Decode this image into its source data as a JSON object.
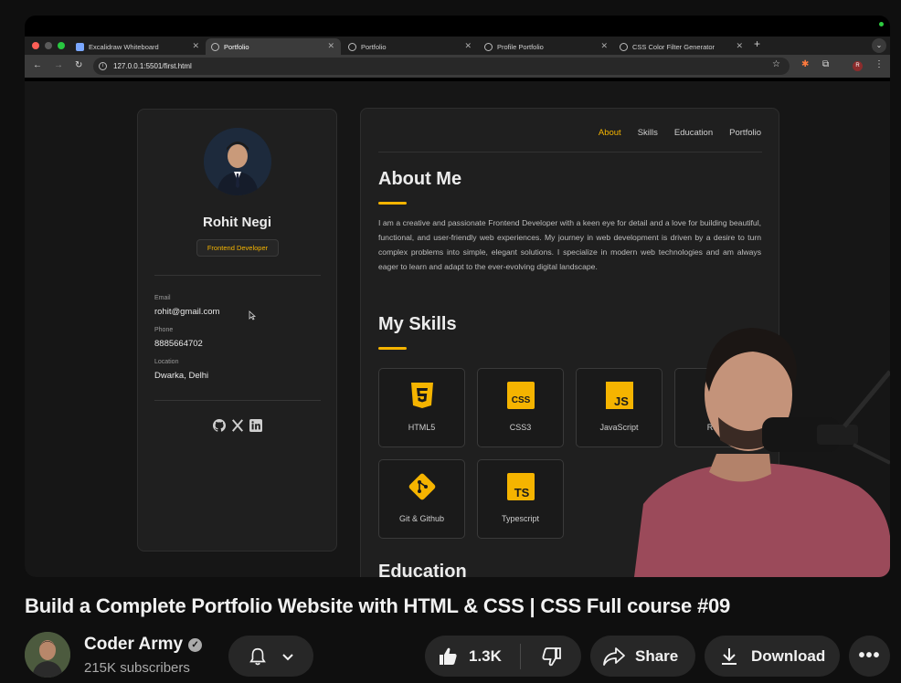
{
  "browser": {
    "tabs": [
      {
        "title": "Excalidraw Whiteboard",
        "active": false
      },
      {
        "title": "Portfolio",
        "active": true
      },
      {
        "title": "Portfolio",
        "active": false
      },
      {
        "title": "Profile Portfolio",
        "active": false
      },
      {
        "title": "CSS Color Filter Generator",
        "active": false
      }
    ],
    "url": "127.0.0.1:5501/first.html",
    "profile_initial": "R"
  },
  "profile": {
    "name": "Rohit Negi",
    "role": "Frontend Developer",
    "contacts": [
      {
        "label": "Email",
        "value": "rohit@gmail.com"
      },
      {
        "label": "Phone",
        "value": "8885664702"
      },
      {
        "label": "Location",
        "value": "Dwarka, Delhi"
      }
    ],
    "socials": [
      "github-icon",
      "x-icon",
      "linkedin-icon"
    ]
  },
  "nav": {
    "items": [
      "About",
      "Skills",
      "Education",
      "Portfolio"
    ],
    "active": "About"
  },
  "about": {
    "title": "About Me",
    "text": "I am a creative and passionate Frontend Developer with a keen eye for detail and a love for building beautiful, functional, and user-friendly web experiences. My journey in web development is driven by a desire to turn complex problems into simple, elegant solutions. I specialize in modern web technologies and am always eager to learn and adapt to the ever-evolving digital landscape."
  },
  "skills": {
    "title": "My Skills",
    "items": [
      {
        "label": "HTML5",
        "icon": "html5-icon"
      },
      {
        "label": "CSS3",
        "icon": "css3-icon"
      },
      {
        "label": "JavaScript",
        "icon": "javascript-icon"
      },
      {
        "label": "React",
        "icon": "react-icon"
      },
      {
        "label": "Git & Github",
        "icon": "git-icon"
      },
      {
        "label": "Typescript",
        "icon": "typescript-icon"
      }
    ]
  },
  "education": {
    "title": "Education"
  },
  "video": {
    "title": "Build a Complete Portfolio Website with HTML & CSS | CSS Full course #09",
    "channel": "Coder Army",
    "subscribers": "215K subscribers",
    "likes": "1.3K",
    "share_label": "Share",
    "download_label": "Download"
  },
  "colors": {
    "accent": "#f5b400",
    "background": "#0f0f0f",
    "card": "#1f1f1f"
  }
}
